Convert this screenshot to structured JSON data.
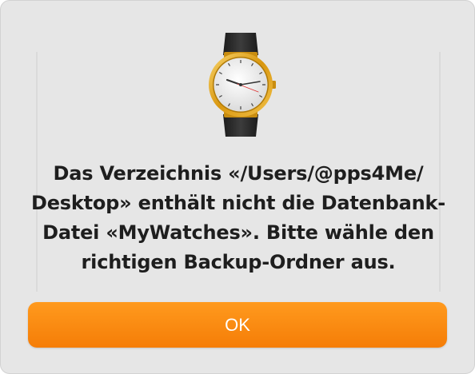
{
  "dialog": {
    "icon": "wristwatch-icon",
    "message_lines": [
      "Das Verzeichnis «/Users/@pps4Me/",
      "Desktop» enthält nicht die Datenbank-",
      "Datei «MyWatches». Bitte wähle den",
      "richtigen Backup-Ordner aus."
    ],
    "ok_label": "OK"
  },
  "colors": {
    "dialog_background": "#e6e6e6",
    "button_orange": "#f7850e",
    "button_text": "#ffffff",
    "message_text": "#1e1e1e",
    "watch_case_gold": "#e0a21a",
    "watch_strap": "#2a2a2a"
  }
}
